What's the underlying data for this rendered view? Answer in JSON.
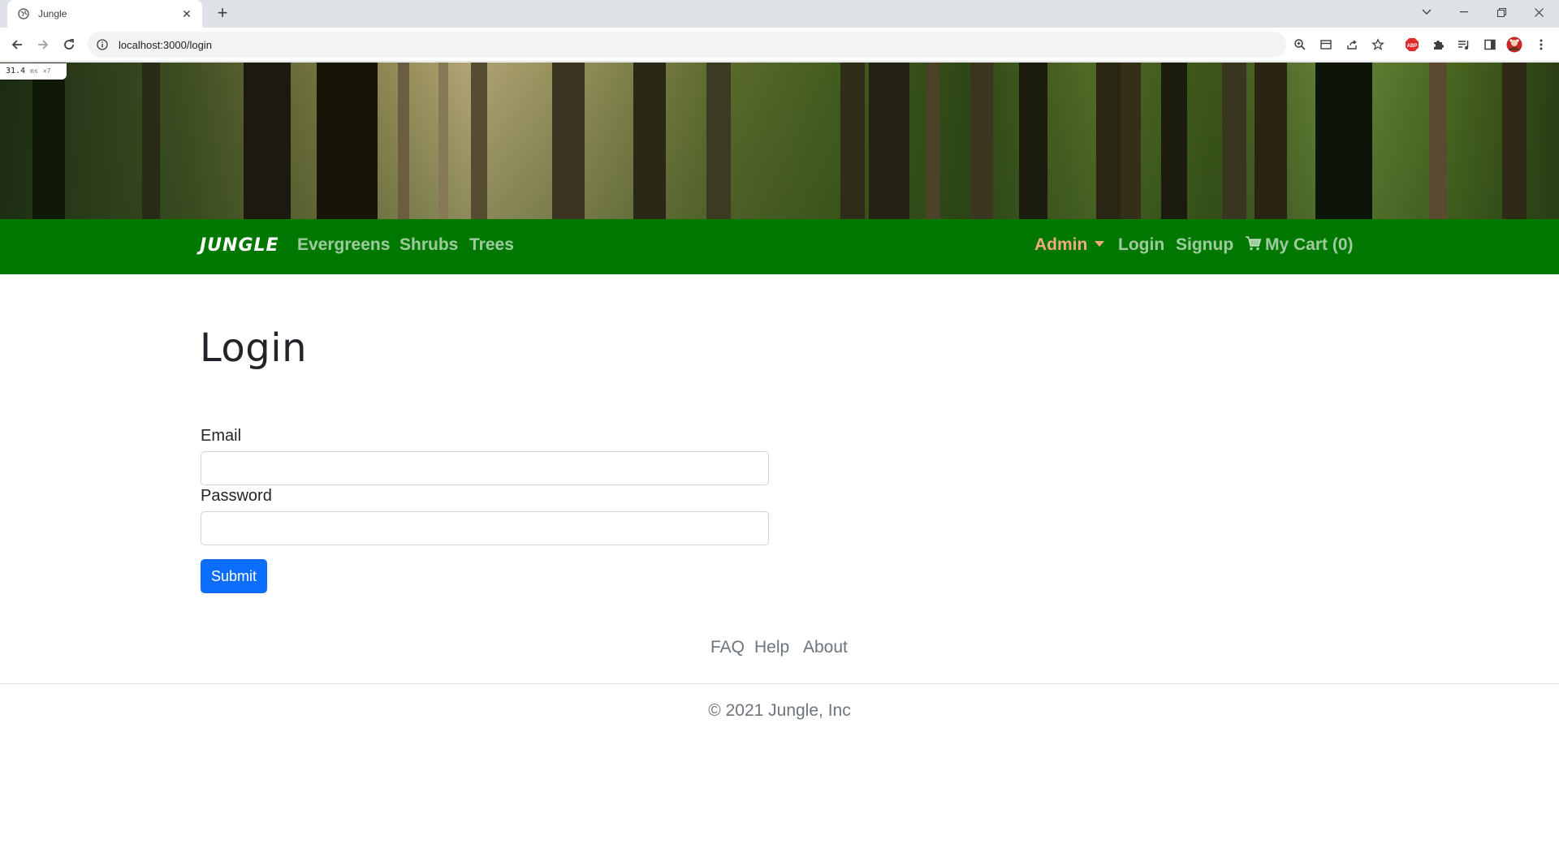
{
  "browser": {
    "tab_title": "Jungle",
    "new_tab_icon": "plus-icon",
    "url": "localhost:3000/login",
    "perf_value": "31.4",
    "perf_unit": "ms",
    "perf_count": "×7",
    "window_controls": [
      "chevron-down-icon",
      "minimize-icon",
      "restore-icon",
      "close-icon"
    ],
    "extensions": [
      "zoom-icon",
      "reader-icon",
      "share-icon",
      "bookmark-star-icon",
      "adblock-icon",
      "puzzle-icon",
      "media-icon",
      "sidepanel-icon",
      "profile-avatar-icon",
      "kebab-menu-icon"
    ],
    "adblock_label": "ABP"
  },
  "navbar": {
    "brand": "JUNGLE",
    "left_links": [
      "Evergreens",
      "Shrubs",
      "Trees"
    ],
    "admin": "Admin",
    "login": "Login",
    "signup": "Signup",
    "cart": "My Cart (0)",
    "colors": {
      "background": "#007800",
      "admin": "#f3a981"
    }
  },
  "main": {
    "title": "Login",
    "email_label": "Email",
    "email_value": "",
    "password_label": "Password",
    "password_value": "",
    "submit_label": "Submit",
    "submit_color": "#0d6efd"
  },
  "footer": {
    "links": [
      "FAQ",
      "Help",
      "About"
    ],
    "copyright": "© 2021 Jungle, Inc"
  }
}
